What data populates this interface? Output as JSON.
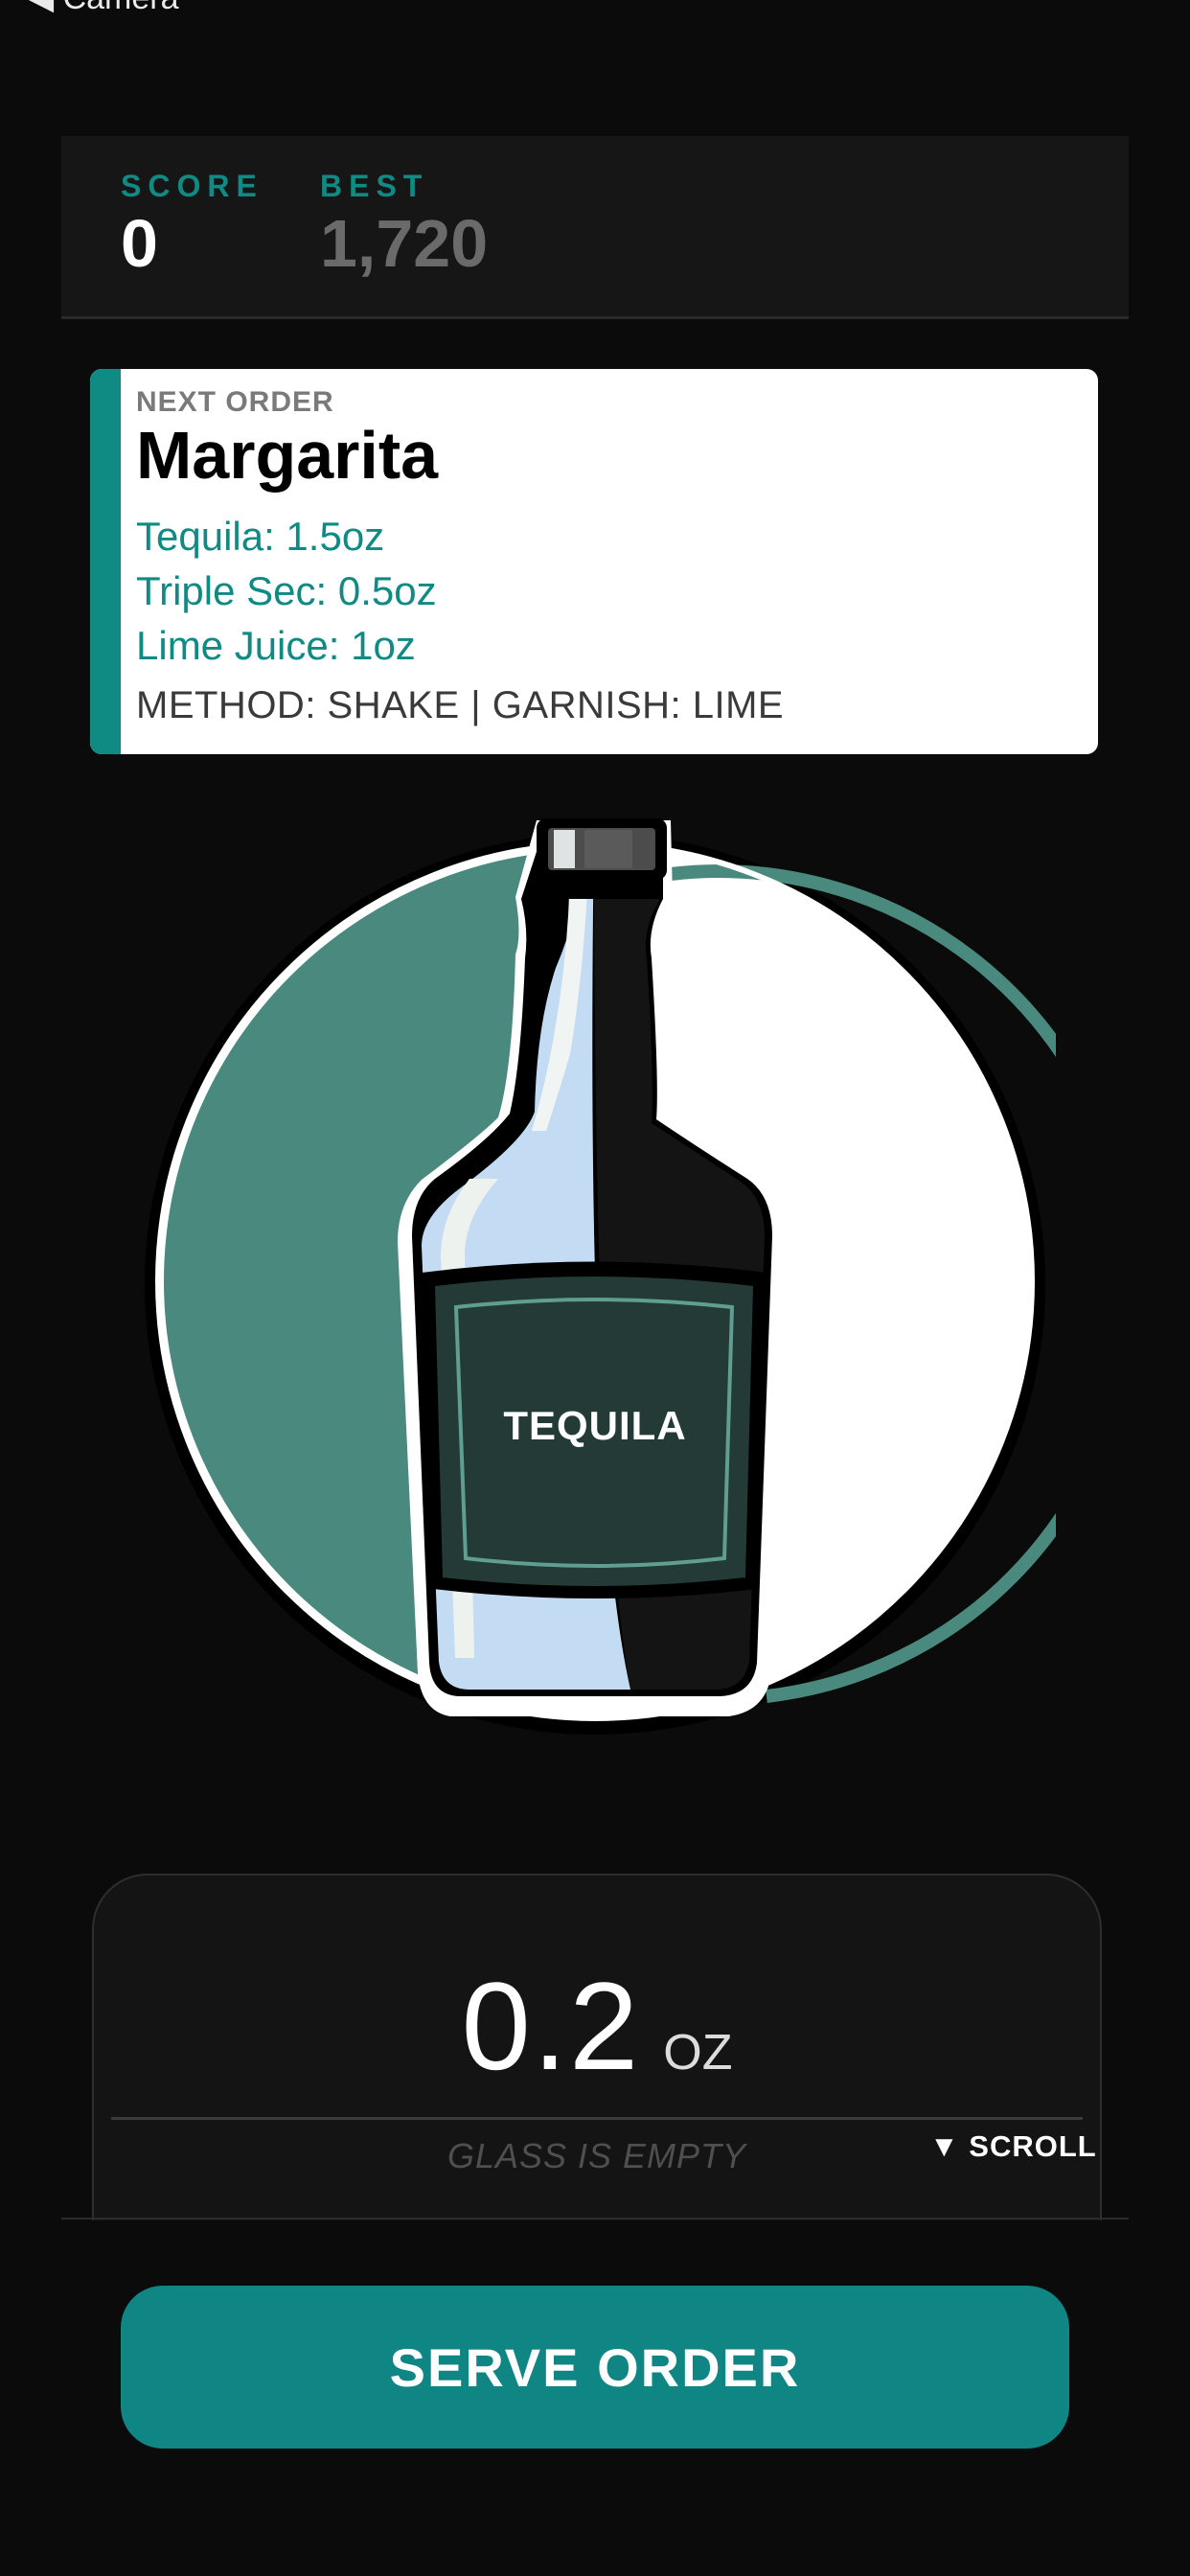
{
  "nav": {
    "back_label": "◀ Camera"
  },
  "scoreboard": {
    "score_label": "SCORE",
    "score_value": "0",
    "best_label": "BEST",
    "best_value": "1,720"
  },
  "order": {
    "label": "NEXT ORDER",
    "name": "Margarita",
    "ingredients": [
      "Tequila: 1.5oz",
      "Triple Sec: 0.5oz",
      "Lime Juice: 1oz"
    ],
    "method": "METHOD: SHAKE | GARNISH: LIME"
  },
  "bottle": {
    "label": "TEQUILA",
    "icon": "tequila-bottle-icon"
  },
  "pour": {
    "amount": "0.2",
    "unit": "OZ",
    "status": "GLASS IS EMPTY",
    "scroll_hint": "▼ SCROLL"
  },
  "actions": {
    "serve_label": "SERVE ORDER"
  },
  "colors": {
    "accent": "#0f8b84",
    "background": "#0b0b0b",
    "panel": "#161616",
    "button": "#0f8584"
  }
}
